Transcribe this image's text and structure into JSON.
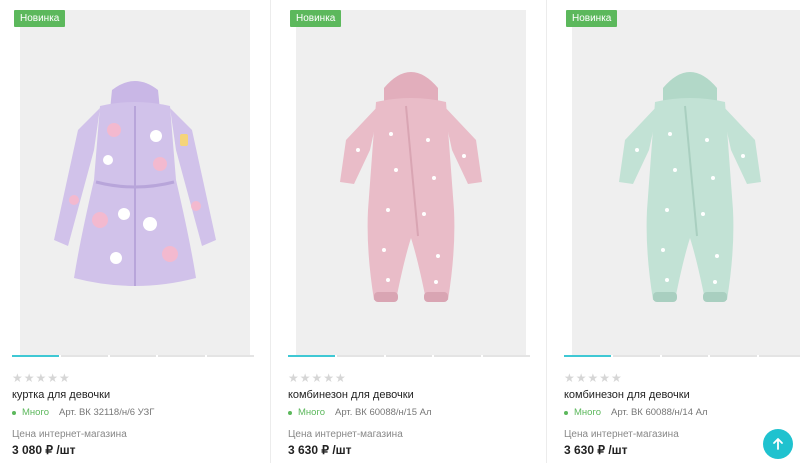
{
  "products": [
    {
      "badge": "Новинка",
      "stars": "★★★★★",
      "title": "куртка для девочки",
      "stock": "Много",
      "article": "Арт. ВК 32118/н/6 УЗГ",
      "price_label": "Цена интернет-магазина",
      "price": "3 080 ₽ /шт",
      "colors": {
        "garment": "#d1c2ea",
        "trim": "#b8a5da",
        "print": "#f3b9cf"
      }
    },
    {
      "badge": "Новинка",
      "stars": "★★★★★",
      "title": "комбинезон для девочки",
      "stock": "Много",
      "article": "Арт. ВК 60088/н/15 Ал",
      "price_label": "Цена интернет-магазина",
      "price": "3 630 ₽ /шт",
      "colors": {
        "garment": "#e9bcc8",
        "trim": "#d9a5b3",
        "print": "#ffffff"
      }
    },
    {
      "badge": "Новинка",
      "stars": "★★★★★",
      "title": "комбинезон для девочки",
      "stock": "Много",
      "article": "Арт. ВК 60088/н/14 Ал",
      "price_label": "Цена интернет-магазина",
      "price": "3 630 ₽ /шт",
      "colors": {
        "garment": "#c2e2d5",
        "trim": "#a9cfc0",
        "print": "#ffffff"
      }
    }
  ],
  "scroll_top_icon": "arrow-up-icon",
  "accent_color": "#1fc2cf",
  "badge_color": "#5cb85c"
}
